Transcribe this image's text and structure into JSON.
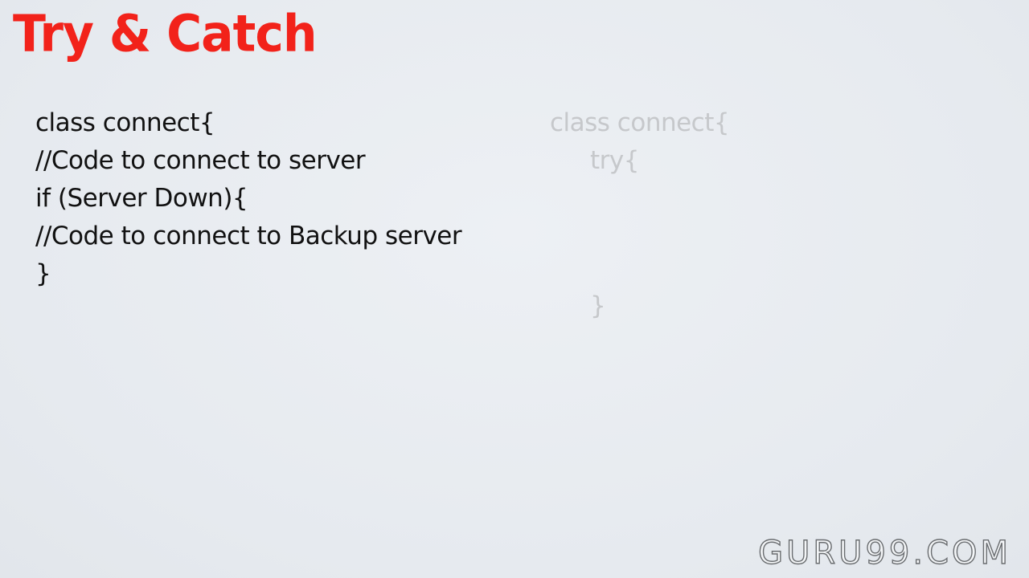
{
  "title": "Try & Catch",
  "code_left": {
    "lines": [
      "class connect{",
      "//Code to connect to server",
      "if (Server Down){",
      "//Code to connect to Backup server",
      "}"
    ]
  },
  "code_right": {
    "line_class": "class connect{",
    "line_try": "try{",
    "line_close": "}"
  },
  "watermark": "GURU99.COM",
  "colors": {
    "title": "#f2221a",
    "background": "#e8ecf1",
    "code": "#111111",
    "ghost_code": "#c6c8cb"
  }
}
